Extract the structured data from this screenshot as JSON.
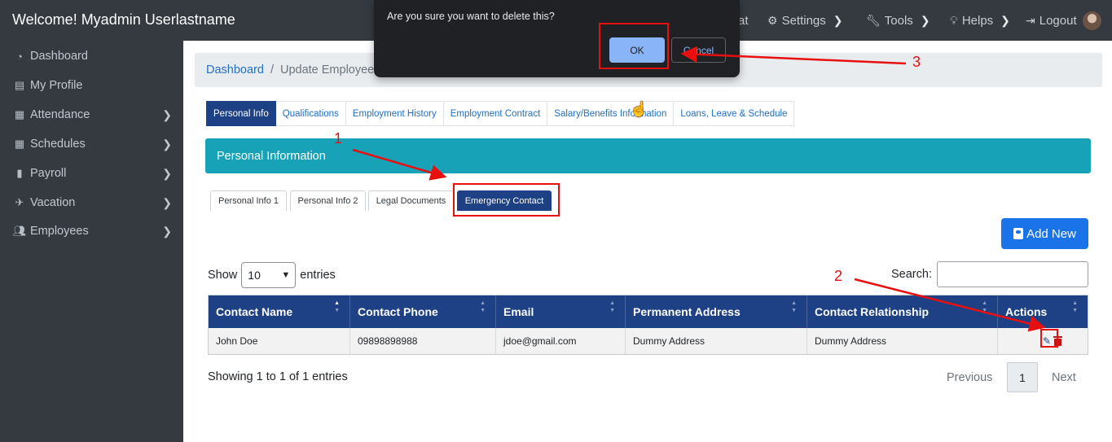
{
  "header": {
    "welcome": "Welcome! Myadmin Userlastname",
    "nav": [
      {
        "label": "at",
        "icon": ""
      },
      {
        "label": "Settings",
        "icon": "gears-icon"
      },
      {
        "label": "Tools",
        "icon": "wrench-icon"
      },
      {
        "label": "Helps",
        "icon": "lightbulb-icon"
      },
      {
        "label": "Logout",
        "icon": "logout-icon"
      }
    ]
  },
  "sidebar": {
    "items": [
      {
        "label": "Dashboard",
        "icon": "dashboard-icon"
      },
      {
        "label": "My Profile",
        "icon": "id-card-icon"
      },
      {
        "label": "Attendance",
        "icon": "calendar-icon"
      },
      {
        "label": "Schedules",
        "icon": "table-icon"
      },
      {
        "label": "Payroll",
        "icon": "file-icon"
      },
      {
        "label": "Vacation",
        "icon": "plane-icon"
      },
      {
        "label": "Employees",
        "icon": "users-icon"
      }
    ]
  },
  "breadcrumb": {
    "home": "Dashboard",
    "separator": "/",
    "current": "Update Employee"
  },
  "main_tabs": [
    "Personal Info",
    "Qualifications",
    "Employment History",
    "Employment Contract",
    "Salary/Benefits Information",
    "Loans, Leave & Schedule"
  ],
  "section": {
    "title": "Personal Information"
  },
  "sub_tabs": [
    "Personal Info 1",
    "Personal Info 2",
    "Legal Documents",
    "Emergency Contact"
  ],
  "add_button": "Add New",
  "table_controls": {
    "show_label": "Show",
    "entries_label": "entries",
    "page_size": "10",
    "search_label": "Search:"
  },
  "table": {
    "columns": [
      "Contact Name",
      "Contact Phone",
      "Email",
      "Permanent Address",
      "Contact Relationship",
      "Actions"
    ],
    "rows": [
      [
        "John Doe",
        "09898898988",
        "jdoe@gmail.com",
        "Dummy Address",
        "Dummy Address"
      ]
    ]
  },
  "footer": {
    "info": "Showing 1 to 1 of 1 entries",
    "previous": "Previous",
    "page": "1",
    "next": "Next"
  },
  "dialog": {
    "message": "Are you sure you want to delete this?",
    "ok": "OK",
    "cancel": "Cancel"
  },
  "annotations": [
    "1",
    "2",
    "3"
  ],
  "colors": {
    "sidebar": "#343a40",
    "primary": "#1e4185",
    "info": "#17a2b8",
    "add_button": "#1a73e8",
    "annotation": "#e8100f"
  }
}
